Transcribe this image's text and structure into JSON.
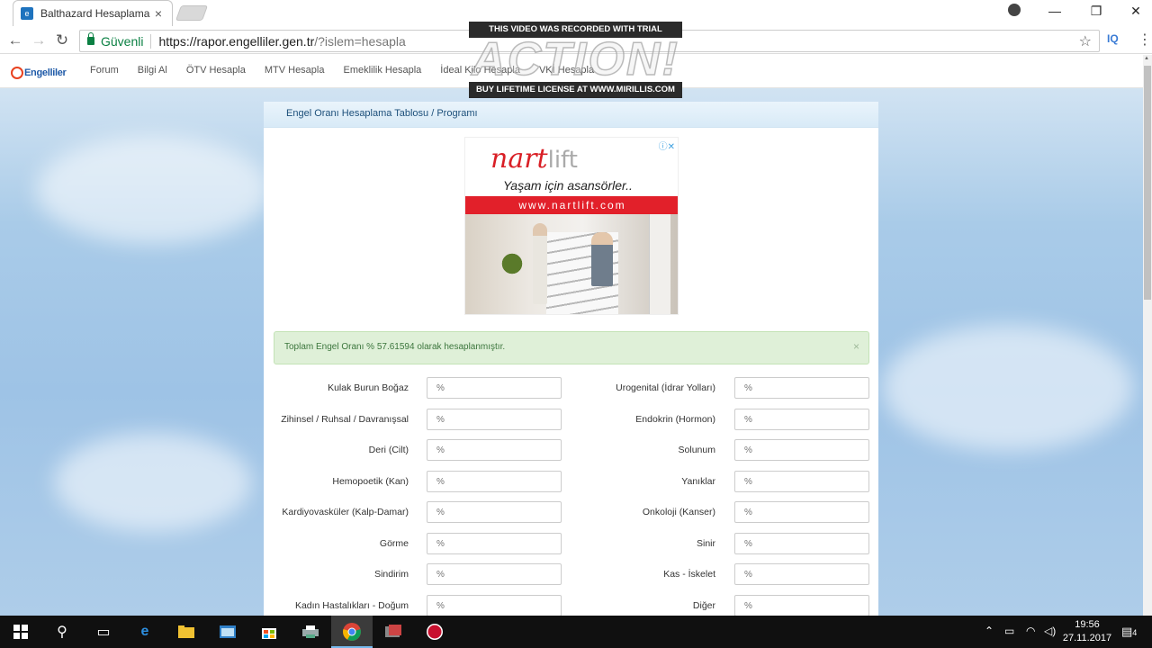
{
  "browser": {
    "tab_title": "Balthazard Hesaplama Pr",
    "secure_label": "Güvenli",
    "url_main": "https://rapor.engelliler.gen.tr",
    "url_rest": "/?islem=hesapla",
    "ext_label": "IQ"
  },
  "site": {
    "logo_text": "Engelliler",
    "nav": [
      "Forum",
      "Bilgi Al",
      "ÖTV Hesapla",
      "MTV Hesapla",
      "Emeklilik Hesapla",
      "İdeal Kilo Hesapla",
      "VKİ Hesapla"
    ]
  },
  "panel": {
    "title": "Engel Oranı Hesaplama Tablosu / Programı"
  },
  "ad": {
    "brand": "nart",
    "brand_suffix": "lift",
    "slogan": "Yaşam için asansörler..",
    "url": "www.nartlift.com"
  },
  "result": {
    "message": "Toplam Engel Oranı % 57.61594 olarak hesaplanmıştır."
  },
  "fields_left": [
    {
      "label": "Kulak Burun Boğaz",
      "placeholder": "%"
    },
    {
      "label": "Zihinsel / Ruhsal / Davranışsal",
      "placeholder": "%"
    },
    {
      "label": "Deri (Cilt)",
      "placeholder": "%"
    },
    {
      "label": "Hemopoetik (Kan)",
      "placeholder": "%"
    },
    {
      "label": "Kardiyovasküler (Kalp-Damar)",
      "placeholder": "%"
    },
    {
      "label": "Görme",
      "placeholder": "%"
    },
    {
      "label": "Sindirim",
      "placeholder": "%"
    },
    {
      "label": "Kadın Hastalıkları - Doğum",
      "placeholder": "%"
    }
  ],
  "fields_right": [
    {
      "label": "Urogenital (İdrar Yolları)",
      "placeholder": "%"
    },
    {
      "label": "Endokrin (Hormon)",
      "placeholder": "%"
    },
    {
      "label": "Solunum",
      "placeholder": "%"
    },
    {
      "label": "Yanıklar",
      "placeholder": "%"
    },
    {
      "label": "Onkoloji (Kanser)",
      "placeholder": "%"
    },
    {
      "label": "Sinir",
      "placeholder": "%"
    },
    {
      "label": "Kas - İskelet",
      "placeholder": "%"
    },
    {
      "label": "Diğer",
      "placeholder": "%"
    }
  ],
  "watermark": {
    "top": "THIS VIDEO WAS RECORDED WITH TRIAL VERSION",
    "logo": "ACTION!",
    "bottom": "BUY LIFETIME LICENSE AT WWW.MIRILLIS.COM"
  },
  "taskbar": {
    "time": "19:56",
    "date": "27.11.2017",
    "notification_count": "4"
  }
}
